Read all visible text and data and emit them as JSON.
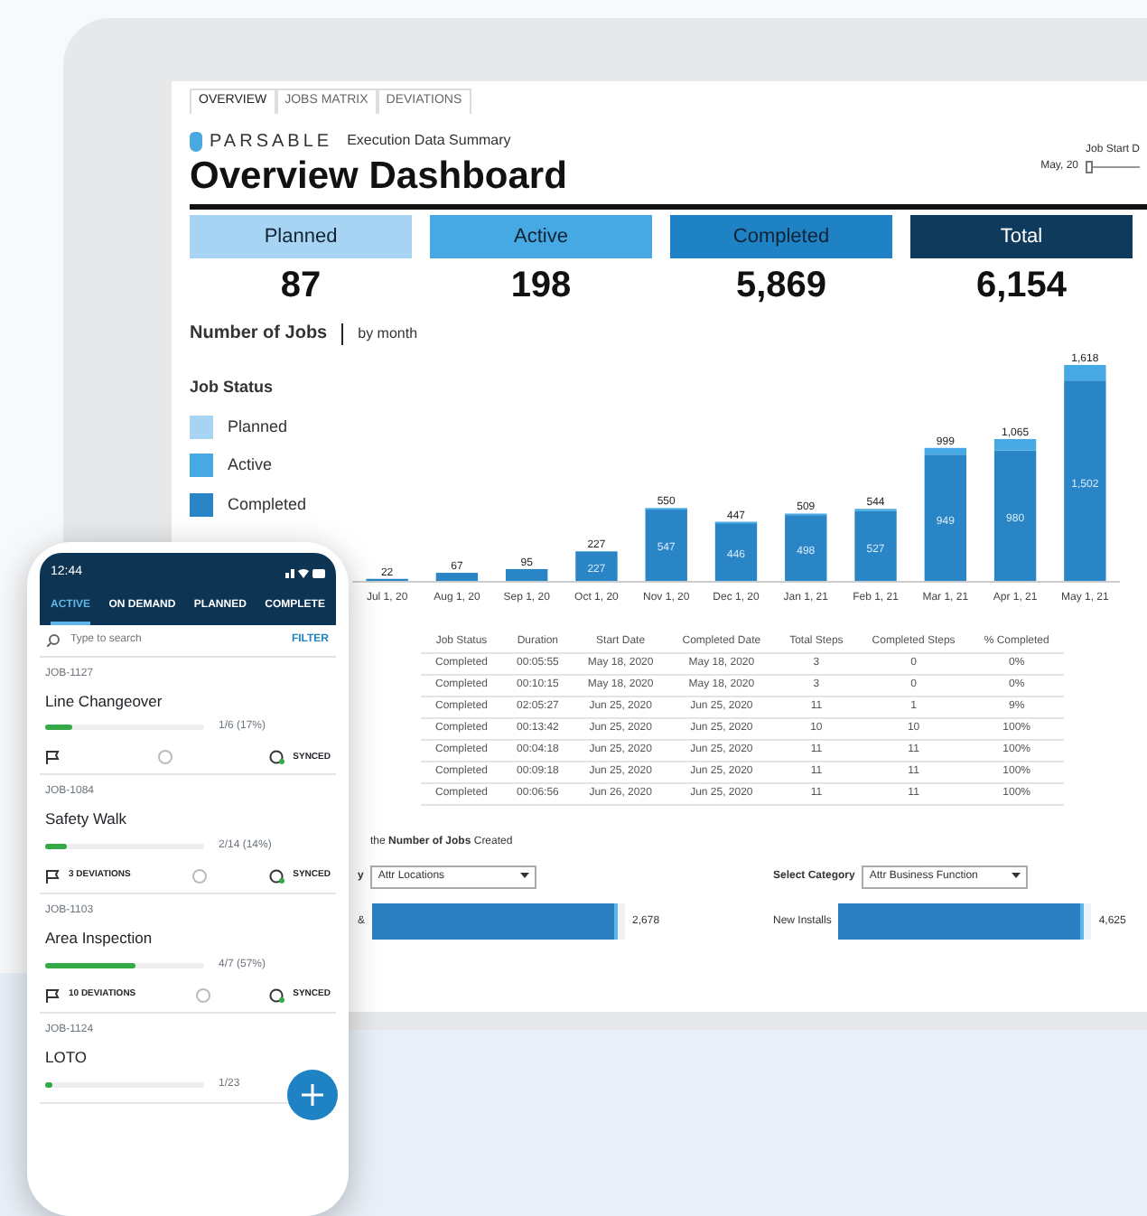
{
  "dashboard": {
    "tabs": [
      {
        "label": "OVERVIEW",
        "selected": true
      },
      {
        "label": "JOBS MATRIX",
        "selected": false
      },
      {
        "label": "DEVIATIONS",
        "selected": false
      }
    ],
    "brand": "PARSABLE",
    "subtitle": "Execution Data Summary",
    "title": "Overview Dashboard",
    "date_filter": {
      "label": "Job Start D",
      "start": "May, 20",
      "level": 0
    },
    "kpis": [
      {
        "label": "Planned",
        "value": "87",
        "color": "#a6d4f2"
      },
      {
        "label": "Active",
        "value": "198",
        "color": "#47a9e3"
      },
      {
        "label": "Completed",
        "value": "5,869",
        "color": "#1f82c4"
      },
      {
        "label": "Total",
        "value": "6,154",
        "color": "#0f3a5c"
      }
    ],
    "chart_heading": "Number of Jobs",
    "chart_subheading": "by month",
    "legend_title": "Job Status",
    "chart_data": {
      "type": "bar",
      "stacked": true,
      "categories": [
        "Jul 1, 20",
        "Aug 1, 20",
        "Sep 1, 20",
        "Oct 1, 20",
        "Nov 1, 20",
        "Dec 1, 20",
        "Jan 1, 21",
        "Feb 1, 21",
        "Mar 1, 21",
        "Apr 1, 21",
        "May 1, 21"
      ],
      "series": [
        {
          "name": "Completed",
          "color": "#2a85c6",
          "values": [
            22,
            67,
            95,
            227,
            547,
            446,
            498,
            527,
            949,
            980,
            1502
          ],
          "value_labels": [
            null,
            null,
            null,
            "227",
            "547",
            "446",
            "498",
            "527",
            "949",
            "980",
            "1,502"
          ]
        },
        {
          "name": "Active",
          "color": "#47a9e3",
          "values": [
            0,
            0,
            0,
            0,
            3,
            1,
            11,
            17,
            50,
            85,
            116
          ],
          "value_labels": [
            null,
            null,
            null,
            null,
            null,
            null,
            null,
            null,
            null,
            null,
            null
          ]
        },
        {
          "name": "Planned",
          "color": "#a6d4f2",
          "values": [
            null,
            null,
            null,
            null,
            null,
            null,
            null,
            null,
            null,
            null,
            null
          ],
          "value_labels": [
            null,
            null,
            null,
            null,
            null,
            null,
            null,
            null,
            null,
            null,
            null
          ]
        }
      ],
      "annotations": [
        "22",
        "67",
        "95",
        "227",
        "550",
        "447",
        "509",
        "544",
        "999",
        "1,065",
        "1,618"
      ]
    },
    "table": {
      "columns": [
        "Job Status",
        "Duration",
        "Start Date",
        "Completed Date",
        "Total Steps",
        "Completed Steps",
        "% Completed"
      ],
      "rows": [
        [
          "Completed",
          "00:05:55",
          "May 18, 2020",
          "May 18, 2020",
          "3",
          "0",
          "0%"
        ],
        [
          "Completed",
          "00:10:15",
          "May 18, 2020",
          "May 18, 2020",
          "3",
          "0",
          "0%"
        ],
        [
          "Completed",
          "02:05:27",
          "Jun 25, 2020",
          "Jun 25, 2020",
          "11",
          "1",
          "9%"
        ],
        [
          "Completed",
          "00:13:42",
          "Jun 25, 2020",
          "Jun 25, 2020",
          "10",
          "10",
          "100%"
        ],
        [
          "Completed",
          "00:04:18",
          "Jun 25, 2020",
          "Jun 25, 2020",
          "11",
          "11",
          "100%"
        ],
        [
          "Completed",
          "00:09:18",
          "Jun 25, 2020",
          "Jun 25, 2020",
          "11",
          "11",
          "100%"
        ],
        [
          "Completed",
          "00:06:56",
          "Jun 26, 2020",
          "Jun 25, 2020",
          "11",
          "11",
          "100%"
        ]
      ]
    },
    "breakdown_heading": "the **Number of Jobs** Created",
    "breakdowns": [
      {
        "label": "y",
        "dropdown": "Attr Locations",
        "bar_label": "&",
        "value": "2,678",
        "level": 0.97
      },
      {
        "label": "Select Category",
        "dropdown": "Attr Business Function",
        "bar_label": "New Installs",
        "value": "4,625",
        "level": 0.97
      }
    ]
  },
  "phone": {
    "time": "12:44",
    "tabs": [
      {
        "label": "ACTIVE",
        "selected": true
      },
      {
        "label": "ON DEMAND",
        "selected": false
      },
      {
        "label": "PLANNED",
        "selected": false
      },
      {
        "label": "COMPLETE",
        "selected": false
      }
    ],
    "search": {
      "placeholder": "Type to search"
    },
    "filter": "FILTER",
    "jobs": [
      {
        "id": "JOB-1127",
        "name": "Line Changeover",
        "level": 0.17,
        "progress": "1/6 (17%)",
        "sync": "SYNCED"
      },
      {
        "id": "JOB-1084",
        "name": "Safety Walk",
        "level": 0.14,
        "progress": "2/14 (14%)",
        "deviations": "3 DEVIATIONS",
        "sync": "SYNCED"
      },
      {
        "id": "JOB-1103",
        "name": "Area Inspection",
        "level": 0.57,
        "progress": "4/7 (57%)",
        "deviations": "10 DEVIATIONS",
        "sync": "SYNCED"
      },
      {
        "id": "JOB-1124",
        "name": "LOTO",
        "level": 0.04,
        "progress": "1/23"
      }
    ]
  }
}
